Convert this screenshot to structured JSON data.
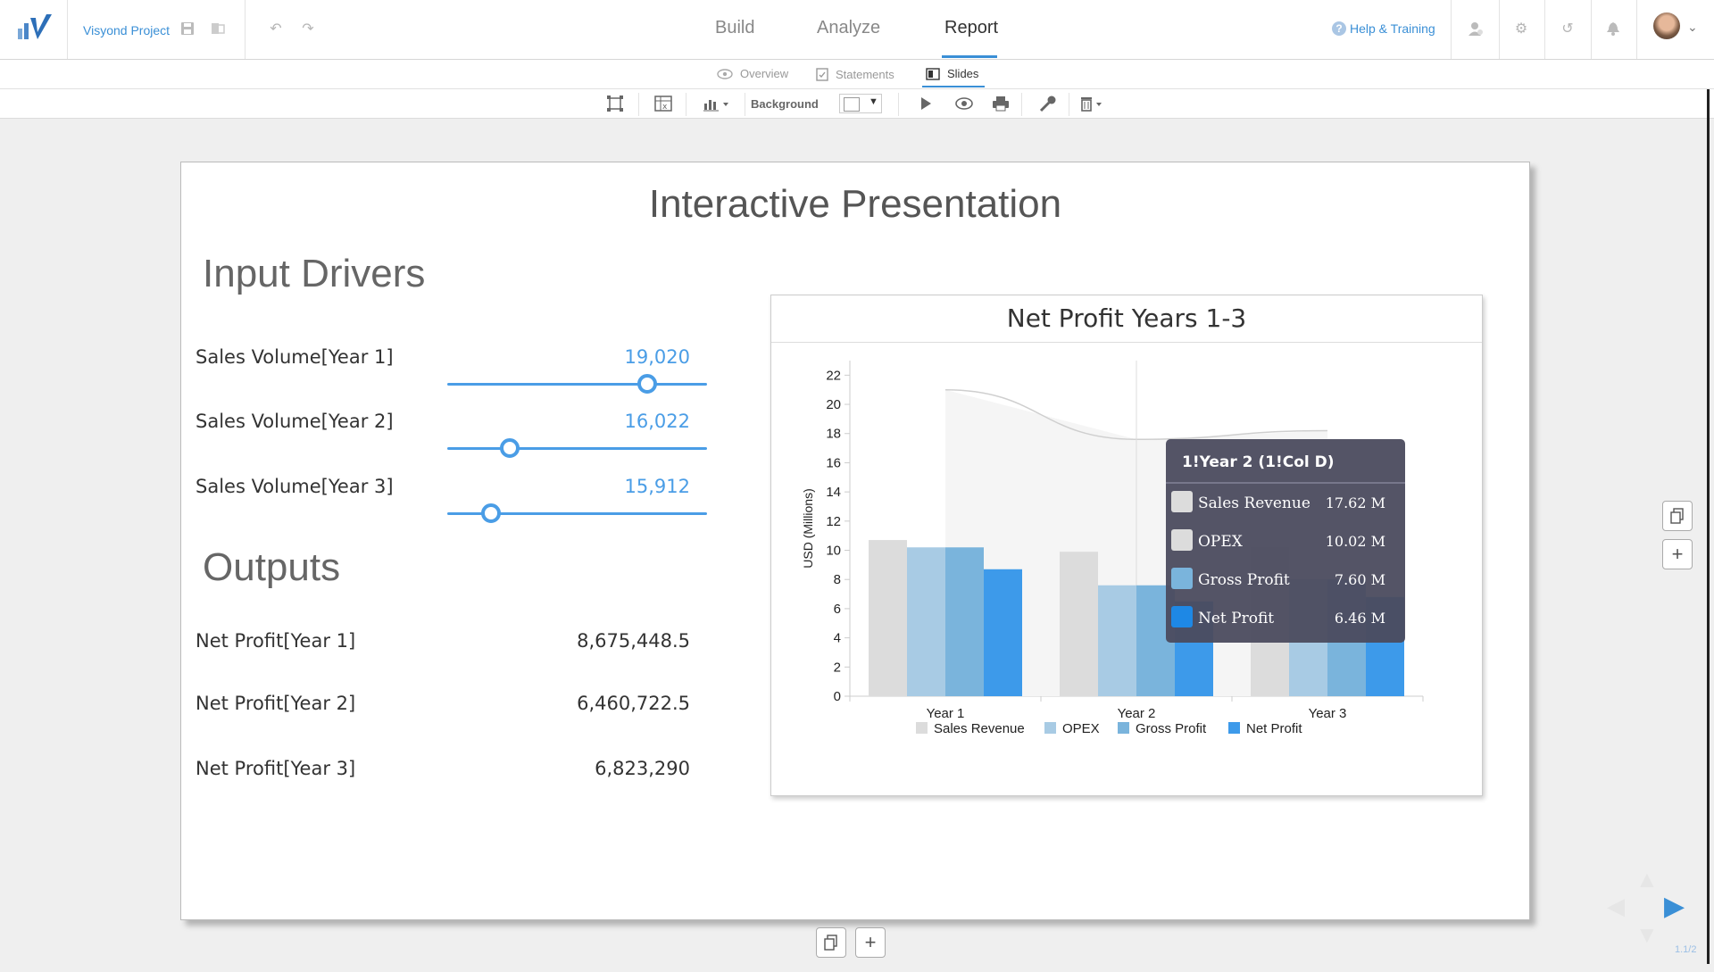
{
  "header": {
    "project_name": "Visyond Project",
    "tabs": [
      {
        "label": "Build",
        "active": false
      },
      {
        "label": "Analyze",
        "active": false
      },
      {
        "label": "Report",
        "active": true
      }
    ],
    "help_label": "Help & Training",
    "icons": [
      "save-icon",
      "export-icon",
      "undo-icon",
      "redo-icon",
      "users-icon",
      "gear-icon",
      "history-icon",
      "bell-icon"
    ]
  },
  "subtabs": [
    {
      "label": "Overview",
      "icon": "eye-icon",
      "active": false
    },
    {
      "label": "Statements",
      "icon": "clipboard-icon",
      "active": false
    },
    {
      "label": "Slides",
      "icon": "slides-icon",
      "active": true
    }
  ],
  "toolbar": {
    "background_label": "Background",
    "background_color": "#ffffff"
  },
  "slide": {
    "title": "Interactive Presentation",
    "inputs_heading": "Input Drivers",
    "outputs_heading": "Outputs",
    "drivers": [
      {
        "label": "Sales Volume[Year 1]",
        "value": "19,020",
        "level": 0.77
      },
      {
        "label": "Sales Volume[Year 2]",
        "value": "16,022",
        "level": 0.24
      },
      {
        "label": "Sales Volume[Year 3]",
        "value": "15,912",
        "level": 0.17
      }
    ],
    "outputs": [
      {
        "label": "Net Profit[Year 1]",
        "value": "8,675,448.5"
      },
      {
        "label": "Net Profit[Year 2]",
        "value": "6,460,722.5"
      },
      {
        "label": "Net Profit[Year 3]",
        "value": "6,823,290"
      }
    ]
  },
  "chart_data": {
    "type": "bar",
    "title": "Net Profit Years 1-3",
    "ylabel": "USD (Millions)",
    "xlabel": "",
    "categories": [
      "Year 1",
      "Year 2",
      "Year 3"
    ],
    "ylim": [
      0,
      23
    ],
    "yticks": [
      0,
      2,
      4,
      6,
      8,
      10,
      12,
      14,
      16,
      18,
      20,
      22
    ],
    "series": [
      {
        "name": "Sales Revenue",
        "color": "#dcdcdc",
        "values": [
          10.7,
          9.9,
          10.2
        ]
      },
      {
        "name": "OPEX",
        "color": "#a8cbe4",
        "values": [
          10.2,
          7.6,
          8.0
        ]
      },
      {
        "name": "Gross Profit",
        "color": "#7ab4dc",
        "values": [
          10.2,
          7.6,
          8.0
        ]
      },
      {
        "name": "Net Profit",
        "color": "#3d9aea",
        "values": [
          8.7,
          6.5,
          6.8
        ]
      }
    ],
    "trend_line": [
      21,
      17.6,
      18.2
    ],
    "legend_position": "bottom",
    "grid": false,
    "tooltip": {
      "title": "1!Year 2 (1!Col D)",
      "rows": [
        {
          "label": "Sales Revenue",
          "value": "17.62 M",
          "color": "#dcdcdc"
        },
        {
          "label": "OPEX",
          "value": "10.02 M",
          "color": "#dcdcdc"
        },
        {
          "label": "Gross Profit",
          "value": "7.60 M",
          "color": "#7ab4dc"
        },
        {
          "label": "Net Profit",
          "value": "6.46 M",
          "color": "#1e88e5"
        }
      ]
    }
  },
  "pagination": {
    "label": "1.1/2"
  }
}
